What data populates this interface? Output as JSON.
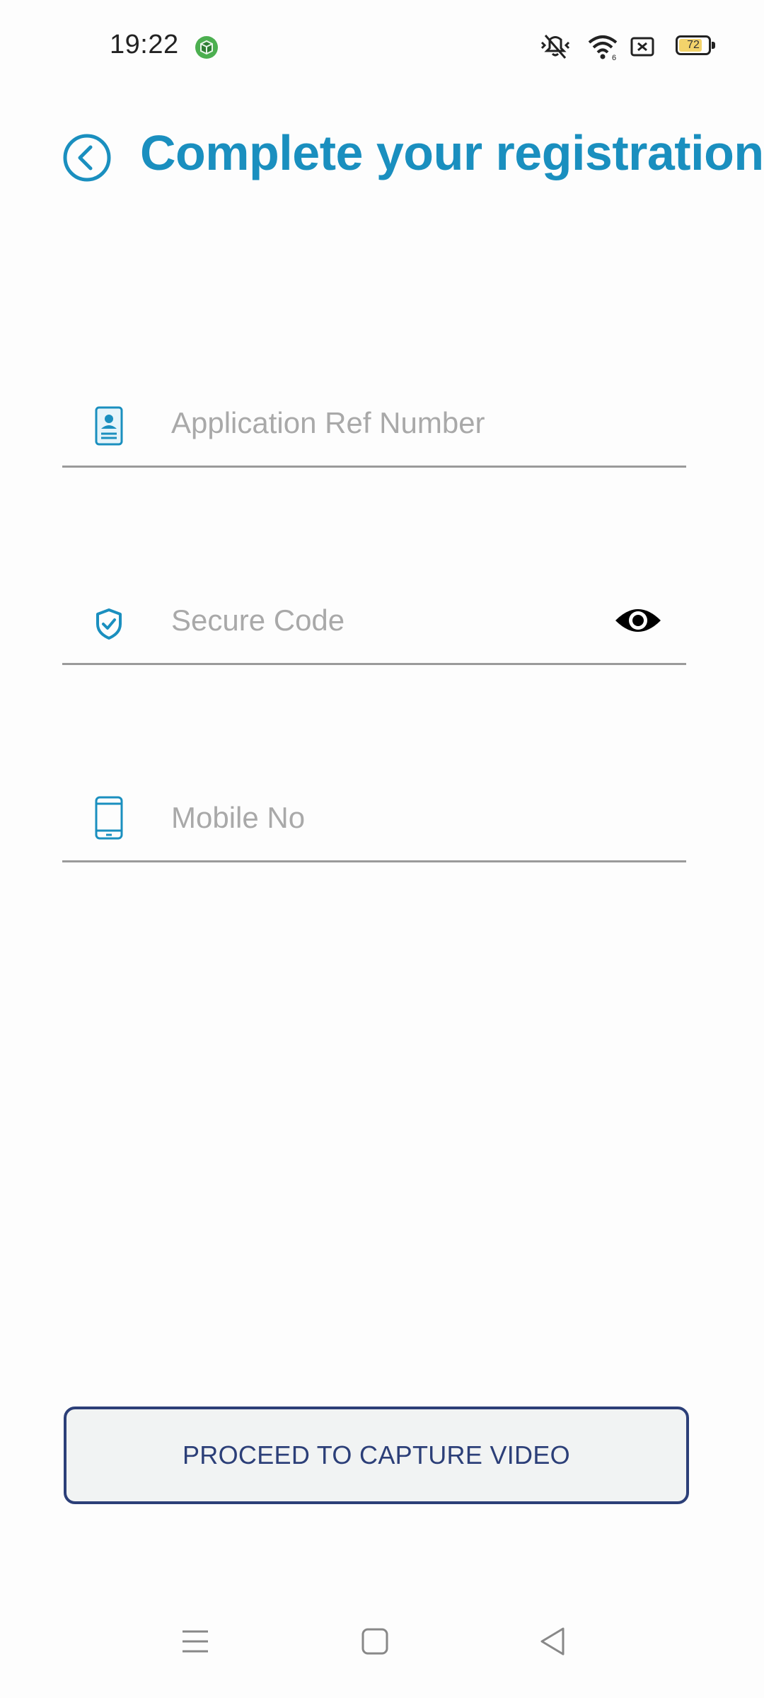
{
  "status_bar": {
    "time": "19:22",
    "battery_level": "72",
    "icons": [
      "app-notification-icon",
      "mute-vibrate-icon",
      "wifi-icon",
      "sim-icon",
      "battery-icon"
    ]
  },
  "header": {
    "title": "Complete your registration",
    "back_icon": "chevron-left-circle-icon"
  },
  "form": {
    "fields": [
      {
        "icon": "id-card-icon",
        "placeholder": "Application Ref Number",
        "value": ""
      },
      {
        "icon": "shield-check-icon",
        "placeholder": "Secure Code",
        "value": "",
        "toggle_icon": "eye-icon"
      },
      {
        "icon": "mobile-phone-icon",
        "placeholder": "Mobile No",
        "value": ""
      }
    ]
  },
  "actions": {
    "proceed_label": "PROCEED TO CAPTURE VIDEO"
  },
  "nav_bar": {
    "buttons": [
      "menu-icon",
      "home-icon",
      "back-triangle-icon"
    ]
  },
  "colors": {
    "accent": "#1a8fbf",
    "button_border": "#2c3f78",
    "button_bg": "#f1f3f3",
    "placeholder": "#a9a9a9",
    "divider": "#9a9a9a"
  }
}
